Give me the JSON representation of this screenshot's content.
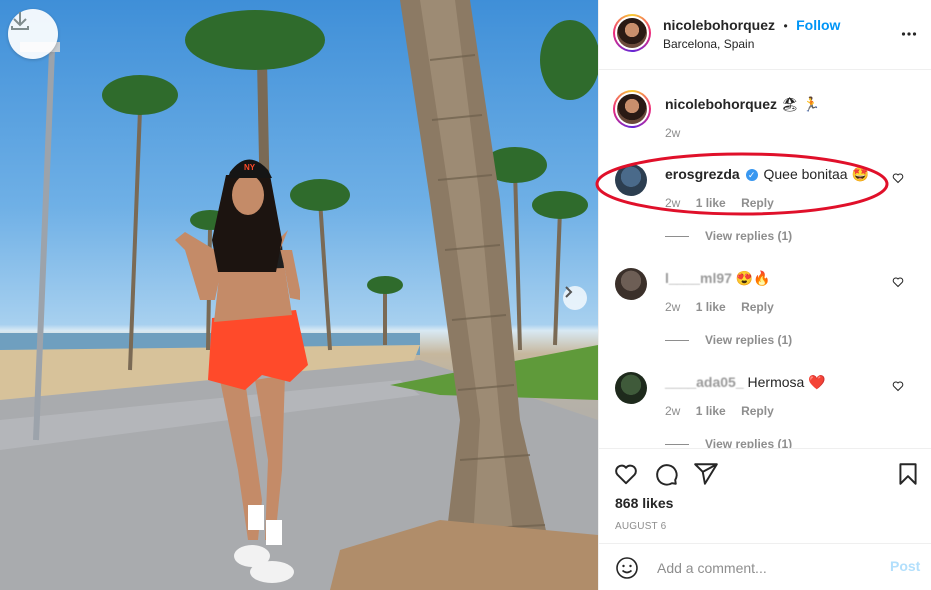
{
  "post": {
    "author": "nicolebohorquez",
    "follow_label": "Follow",
    "separator": "•",
    "location": "Barcelona, Spain",
    "caption_emoji": "🏖 🏃",
    "caption_time": "2w"
  },
  "comments": [
    {
      "username": "erosgrezda",
      "verified": true,
      "text": "Quee bonitaa",
      "emoji": "🤩",
      "time": "2w",
      "likes": "1 like",
      "reply_label": "Reply",
      "view_replies": "View replies (1)"
    },
    {
      "username": "l____ml97",
      "verified": false,
      "text": "",
      "emoji": "😍🔥",
      "time": "2w",
      "likes": "1 like",
      "reply_label": "Reply",
      "view_replies": "View replies (1)"
    },
    {
      "username": "____ada05_",
      "verified": false,
      "text": "Hermosa",
      "emoji": "❤️",
      "time": "2w",
      "likes": "1 like",
      "reply_label": "Reply",
      "view_replies": "View replies (1)"
    }
  ],
  "engagement": {
    "likes": "868 likes",
    "date": "AUGUST 6"
  },
  "composer": {
    "placeholder": "Add a comment...",
    "post_label": "Post"
  },
  "icons": {
    "download": "download-icon",
    "more": "more-options-icon",
    "like": "heart-icon",
    "comment": "comment-icon",
    "share": "paper-plane-icon",
    "save": "bookmark-icon",
    "emoji": "emoji-icon",
    "next": "chevron-right-icon"
  },
  "colors": {
    "link": "#0095f6",
    "annotation": "#e0102a",
    "muted": "#8e8e8e",
    "post_disabled": "#b2dffc"
  }
}
